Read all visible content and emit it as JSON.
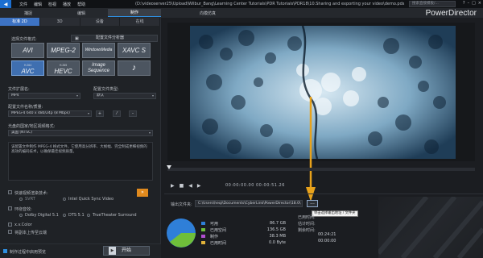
{
  "window": {
    "menu": [
      "文件",
      "编辑",
      "检视",
      "播放",
      "帮助"
    ],
    "path": "(D:\\videoserver25\\Upload\\Wilbur_Bang\\Learning Center Tutorials\\PDR Tutorials\\PDR18\\10.Sharing and exporting your video\\demo.pds",
    "search_placeholder": "搜索直接模板/...",
    "controls": [
      "?",
      "–",
      "□",
      "×"
    ]
  },
  "nav": {
    "tabs": [
      "捕捉",
      "编辑",
      "制作"
    ],
    "active_tab": 2,
    "center_title": "向模仿真",
    "brand": "PowerDirector"
  },
  "left": {
    "subtabs": [
      "标准 2D",
      "3D",
      "设备",
      "在线"
    ],
    "active_subtab": 0,
    "format_label": "选择文件格式:",
    "profile_button": "配置文件分析器",
    "formats": [
      {
        "name": "AVI",
        "sub": ""
      },
      {
        "name": "MPEG-2",
        "sub": ""
      },
      {
        "name": "WindowsMedia",
        "sub": ""
      },
      {
        "name": "XAVC S",
        "sub": ""
      },
      {
        "name": "AVC",
        "sub": "H.264"
      },
      {
        "name": "HEVC",
        "sub": "H.265"
      },
      {
        "name": "Image Sequence",
        "sub": ""
      },
      {
        "name": "♪",
        "sub": ""
      }
    ],
    "selected_format": 4,
    "ext_label": "文件扩展名:",
    "ext_value": "MP4",
    "profile_type_label": "配置文件类型:",
    "profile_type_value": "默认",
    "quality_label": "配置文件名称/质量:",
    "quality_value": "MPEG-4 640 x 480/24p (8 Mbps)",
    "quality_btns": [
      "+",
      "⁄",
      "–"
    ],
    "region_label": "光盘的国家/地区视频格式:",
    "region_value": "美国 (NTSC)",
    "description": "该配置文件制作 MPEG-4 格式文件，它使用高分辨率、大帧幅、完全制成更细视频的高效的编码技术，以确保最佳视频质量。",
    "fast_render_label": "快速视频渲染技术:",
    "svrt_label": "SVRT",
    "intel_label": "Intel Quick Sync Video",
    "surround_label": "环绕音效:",
    "dolby_label": "Dolby Digital 5.1",
    "dts_label": "DTS 5.1",
    "truetheater_label": "TrueTheater Surround",
    "xvcolor_label": "x.v.Color",
    "upload_label": "将副本上传至云端",
    "preview_label": "制作过程中启用预览",
    "start_label": "开始"
  },
  "player": {
    "timecode": "00:00:00.00  00:00:51.26"
  },
  "output": {
    "folder_label": "输出文件夹:",
    "folder_path": "C:\\Users\\heqi\\Documents\\CyberLink\\PowerDirector\\18.0\\",
    "browse_label": "...",
    "tooltip": "单击选择输出地址 / 文件夹",
    "legend": [
      {
        "name": "可用",
        "value": "86.7 GB",
        "color": "#2f7fd8"
      },
      {
        "name": "已用空间",
        "value": "136.5 GB",
        "color": "#6fbf3a"
      },
      {
        "name": "制作",
        "value": "38.3 MB",
        "color": "#b14fd1"
      },
      {
        "name": "已用时间",
        "value": "0.0 Byte",
        "color": "#e0b23a"
      }
    ],
    "time_labels": [
      "已用时间:",
      "估计时间:",
      "剩余时间:",
      ""
    ],
    "time_values": [
      "",
      "",
      "00:24:21",
      "00:00:00"
    ]
  }
}
